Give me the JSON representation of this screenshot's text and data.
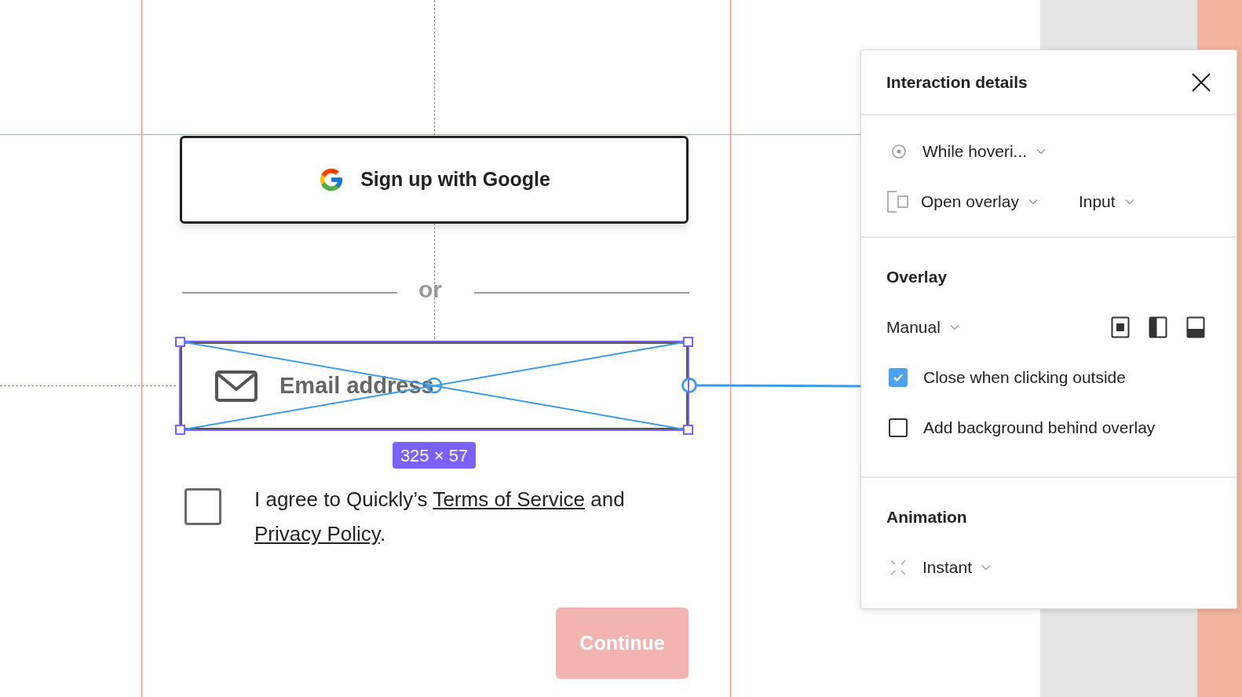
{
  "canvas": {
    "google_button": {
      "label": "Sign up with Google"
    },
    "divider_text": "or",
    "email_field": {
      "placeholder": "Email address",
      "selected": true
    },
    "size_badge": "325 × 57",
    "agree": {
      "checked": false,
      "parts": [
        {
          "kind": "text",
          "text": "I agree to Quickly’s "
        },
        {
          "kind": "link",
          "text": "Terms of Service"
        },
        {
          "kind": "text",
          "text": " and "
        },
        {
          "kind": "link",
          "text": "Privacy Policy"
        },
        {
          "kind": "text",
          "text": "."
        }
      ]
    },
    "continue_button": {
      "label": "Continue",
      "disabled": true
    }
  },
  "panel": {
    "title": "Interaction details",
    "trigger": {
      "label": "While hoveri..."
    },
    "action": {
      "label": "Open overlay",
      "target": "Input"
    },
    "overlay": {
      "heading": "Overlay",
      "position": "Manual",
      "layouts": [
        {
          "kind": "center"
        },
        {
          "kind": "left"
        },
        {
          "kind": "bottom"
        }
      ],
      "options": [
        {
          "label": "Close when clicking outside",
          "checked": true
        },
        {
          "label": "Add background behind overlay",
          "checked": false
        }
      ]
    },
    "animation": {
      "heading": "Animation",
      "type": "Instant"
    }
  }
}
